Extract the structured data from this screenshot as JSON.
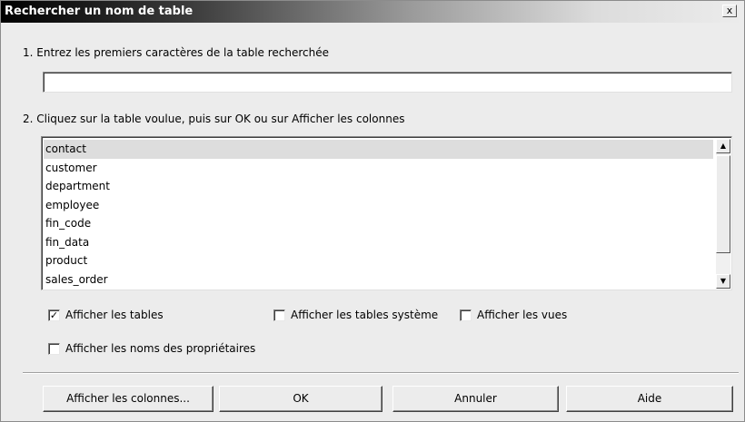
{
  "window": {
    "title": "Rechercher un nom de table",
    "close_label": "x"
  },
  "step1": {
    "label": "1. Entrez les premiers caractères de la table recherchée",
    "input_value": ""
  },
  "step2": {
    "label": "2. Cliquez sur la table voulue, puis sur OK ou sur Afficher les colonnes"
  },
  "tables": [
    "contact",
    "customer",
    "department",
    "employee",
    "fin_code",
    "fin_data",
    "product",
    "sales_order"
  ],
  "selected_table": "contact",
  "options": {
    "show_tables": {
      "label": "Afficher les tables",
      "checked": true
    },
    "show_system_tables": {
      "label": "Afficher les tables système",
      "checked": false
    },
    "show_views": {
      "label": "Afficher les vues",
      "checked": false
    },
    "show_owner_names": {
      "label": "Afficher les noms des propriétaires",
      "checked": false
    }
  },
  "buttons": {
    "show_columns": "Afficher les colonnes...",
    "ok": "OK",
    "cancel": "Annuler",
    "help": "Aide"
  },
  "icons": {
    "checkmark": "check-icon",
    "scroll_up": "arrow-up-icon",
    "scroll_down": "arrow-down-icon"
  }
}
